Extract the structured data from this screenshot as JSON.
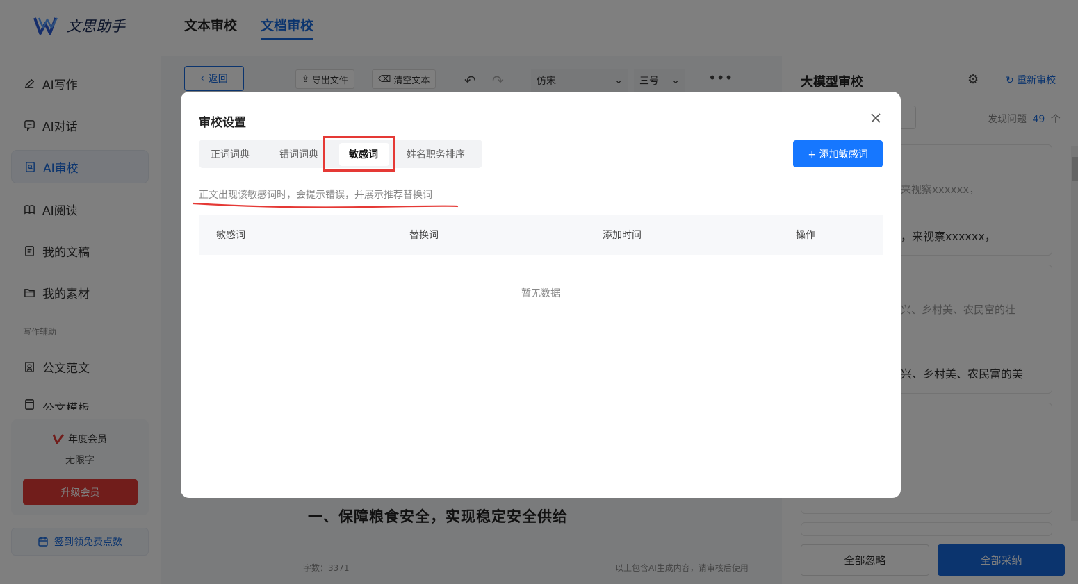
{
  "app": {
    "name": "文思助手"
  },
  "sidebar": {
    "items": [
      {
        "label": "AI写作",
        "icon": "pen-icon"
      },
      {
        "label": "AI对话",
        "icon": "chat-icon"
      },
      {
        "label": "AI审校",
        "icon": "doc-search-icon",
        "active": true
      },
      {
        "label": "AI阅读",
        "icon": "book-icon"
      },
      {
        "label": "我的文稿",
        "icon": "file-icon"
      },
      {
        "label": "我的素材",
        "icon": "folder-icon"
      }
    ],
    "section_label": "写作辅助",
    "assist_items": [
      {
        "label": "公文范文",
        "icon": "bookmark-icon"
      },
      {
        "label": "公文模板",
        "icon": "template-icon"
      }
    ],
    "member": {
      "title": "年度会员",
      "subtitle": "无限字",
      "upgrade_label": "升级会员"
    },
    "checkin_label": "签到领免费点数"
  },
  "top_tabs": [
    {
      "label": "文本审校",
      "active": false
    },
    {
      "label": "文档审校",
      "active": true
    }
  ],
  "toolbar": {
    "back_label": "返回",
    "export_label": "导出文件",
    "clear_label": "清空文本",
    "font_value": "仿宋",
    "size_value": "三号"
  },
  "editor": {
    "heading": "一、保障粮食安全，实现稳定安全供给",
    "word_count": "字数：3371",
    "ai_note": "以上包含AI生成内容，请审核后使用"
  },
  "right_panel": {
    "title": "大模型审校",
    "reset_label": "重新审校",
    "count_prefix": "发现问题",
    "count_value": "49",
    "count_suffix": "个",
    "card1_strike": "来视察xxxxxx，",
    "card1_text": "，来视察xxxxxx，",
    "card2_strike": "兴、乡村美、农民富的壮",
    "card2_text": "兴、乡村美、农民富的美",
    "ignore_all_label": "全部忽略",
    "adopt_all_label": "全部采纳"
  },
  "modal": {
    "title": "审校设置",
    "tabs": [
      "正词词典",
      "错词词典",
      "敏感词",
      "姓名职务排序"
    ],
    "active_tab": "敏感词",
    "add_button_label": "+ 添加敏感词",
    "hint": "正文出现该敏感词时，会提示错误，并展示推荐替换词",
    "columns": [
      "敏感词",
      "替换词",
      "添加时间",
      "操作"
    ],
    "empty_text": "暂无数据"
  },
  "colors": {
    "accent": "#1668dc",
    "danger": "#e23b36",
    "highlight": "#e53935"
  }
}
